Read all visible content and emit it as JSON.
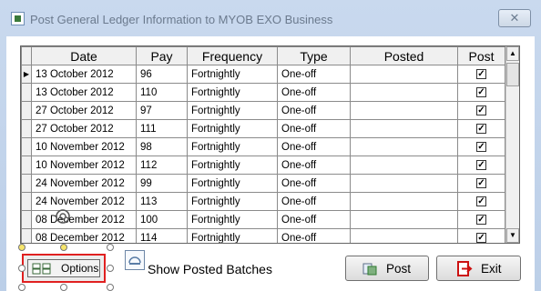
{
  "window": {
    "title": "Post General Ledger Information to MYOB EXO Business"
  },
  "controls": {
    "close_symbol": "✕"
  },
  "grid": {
    "columns": [
      "Date",
      "Pay",
      "Frequency",
      "Type",
      "Posted",
      "Post"
    ],
    "rows": [
      {
        "date": "13 October 2012",
        "pay": "96",
        "frequency": "Fortnightly",
        "type": "One-off",
        "posted": "",
        "post": true
      },
      {
        "date": "13 October 2012",
        "pay": "110",
        "frequency": "Fortnightly",
        "type": "One-off",
        "posted": "",
        "post": true
      },
      {
        "date": "27 October 2012",
        "pay": "97",
        "frequency": "Fortnightly",
        "type": "One-off",
        "posted": "",
        "post": true
      },
      {
        "date": "27 October 2012",
        "pay": "111",
        "frequency": "Fortnightly",
        "type": "One-off",
        "posted": "",
        "post": true
      },
      {
        "date": "10 November 2012",
        "pay": "98",
        "frequency": "Fortnightly",
        "type": "One-off",
        "posted": "",
        "post": true
      },
      {
        "date": "10 November 2012",
        "pay": "112",
        "frequency": "Fortnightly",
        "type": "One-off",
        "posted": "",
        "post": true
      },
      {
        "date": "24 November 2012",
        "pay": "99",
        "frequency": "Fortnightly",
        "type": "One-off",
        "posted": "",
        "post": true
      },
      {
        "date": "24 November 2012",
        "pay": "113",
        "frequency": "Fortnightly",
        "type": "One-off",
        "posted": "",
        "post": true
      },
      {
        "date": "08 December 2012",
        "pay": "100",
        "frequency": "Fortnightly",
        "type": "One-off",
        "posted": "",
        "post": true
      },
      {
        "date": "08 December 2012",
        "pay": "114",
        "frequency": "Fortnightly",
        "type": "One-off",
        "posted": "",
        "post": true
      }
    ],
    "current_row_marker": "▶",
    "check_mark": "✓"
  },
  "scrollbar": {
    "up_symbol": "▲",
    "down_symbol": "▼"
  },
  "buttons": {
    "options_label": "Options",
    "post_label": "Post",
    "exit_label": "Exit"
  },
  "show_posted": {
    "label": "Show Posted Batches"
  },
  "colors": {
    "selection_outline": "#e02020",
    "exit_icon": "#cc1111",
    "post_icon": "#2f7a2f"
  }
}
